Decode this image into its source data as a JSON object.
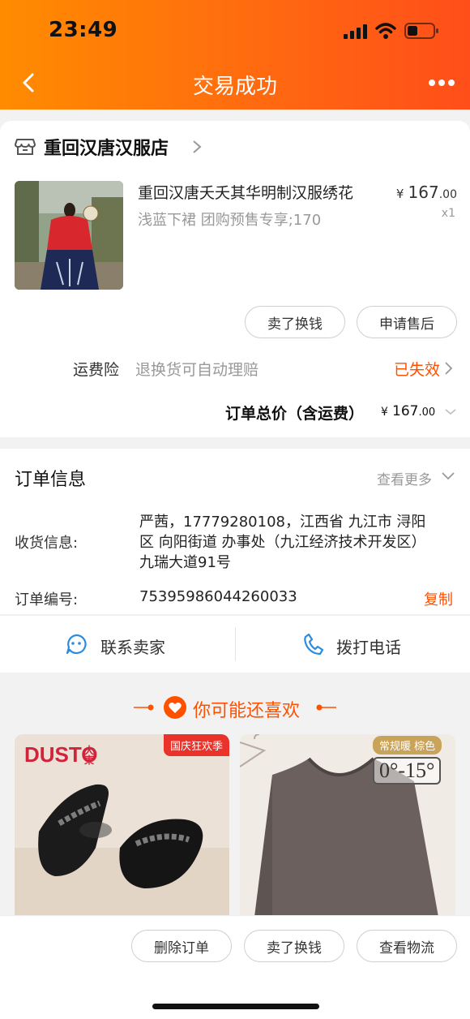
{
  "status_bar": {
    "time": "23:49"
  },
  "nav": {
    "title": "交易成功"
  },
  "shop": {
    "name": "重回汉唐汉服店"
  },
  "product": {
    "title": "重回汉唐夭夭其华明制汉服绣花",
    "sku": "浅蓝下裙 团购预售专享;170",
    "price_symbol": "¥",
    "price_int": "167",
    "price_dec": ".00",
    "qty": "x1",
    "image_colors": {
      "jacket": "#d9272e",
      "skirt": "#1e2a55",
      "background": "#7a8a6a"
    }
  },
  "actions": {
    "sell": "卖了换钱",
    "after_sale": "申请售后"
  },
  "insurance": {
    "label": "运费险",
    "desc": "退换货可自动理赔",
    "status": "已失效"
  },
  "total": {
    "label": "订单总价（含运费）",
    "symbol": "¥",
    "int": "167",
    "dec": ".00"
  },
  "order_info": {
    "title": "订单信息",
    "more": "查看更多",
    "address_label": "收货信息:",
    "address_lines": [
      "严茜，17779280108，江西省 九江市 浔阳",
      "区 向阳街道 办事处（九江经济技术开发区）",
      "九瑞大道91号"
    ],
    "order_no_label": "订单编号:",
    "order_no": "75395986044260033",
    "copy": "复制"
  },
  "contact": {
    "seller": "联系卖家",
    "phone": "拨打电话"
  },
  "recommend": {
    "title": "你可能还喜欢",
    "items": [
      {
        "brand": "DUSTO",
        "brand_cn": "大東",
        "badge": "国庆狂欢季"
      },
      {
        "badge": "常规暖 棕色",
        "temp": "0°-15°"
      }
    ]
  },
  "bottom_bar": {
    "delete": "删除订单",
    "sell": "卖了换钱",
    "logistics": "查看物流"
  },
  "colors": {
    "accent": "#ff5000",
    "header_start": "#ff8c00",
    "header_end": "#ff4e1a"
  }
}
